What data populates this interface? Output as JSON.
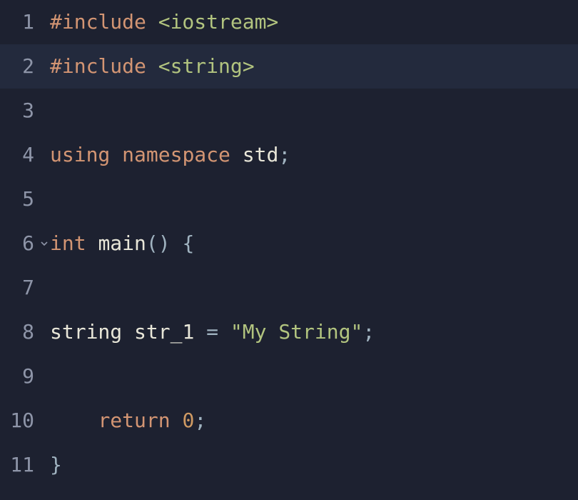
{
  "editor": {
    "highlighted_line_index": 1,
    "fold_marker_line_index": 5,
    "lines": [
      {
        "num": "1",
        "tokens": [
          {
            "t": "#include",
            "c": "tok-preproc"
          },
          {
            "t": " "
          },
          {
            "t": "<iostream>",
            "c": "tok-include"
          }
        ]
      },
      {
        "num": "2",
        "tokens": [
          {
            "t": "#include",
            "c": "tok-preproc"
          },
          {
            "t": " "
          },
          {
            "t": "<string>",
            "c": "tok-include"
          }
        ]
      },
      {
        "num": "3",
        "tokens": []
      },
      {
        "num": "4",
        "tokens": [
          {
            "t": "using",
            "c": "tok-keyword"
          },
          {
            "t": " "
          },
          {
            "t": "namespace",
            "c": "tok-keyword"
          },
          {
            "t": " "
          },
          {
            "t": "std",
            "c": "tok-ident"
          },
          {
            "t": ";",
            "c": "tok-punct"
          }
        ]
      },
      {
        "num": "5",
        "tokens": []
      },
      {
        "num": "6",
        "tokens": [
          {
            "t": "int",
            "c": "tok-type-kw"
          },
          {
            "t": " "
          },
          {
            "t": "main",
            "c": "tok-func"
          },
          {
            "t": "()",
            "c": "tok-punct"
          },
          {
            "t": " "
          },
          {
            "t": "{",
            "c": "tok-punct"
          }
        ]
      },
      {
        "num": "7",
        "tokens": []
      },
      {
        "num": "8",
        "tokens": [
          {
            "t": "string",
            "c": "tok-typeuser"
          },
          {
            "t": " "
          },
          {
            "t": "str_1",
            "c": "tok-ident"
          },
          {
            "t": " "
          },
          {
            "t": "=",
            "c": "tok-op"
          },
          {
            "t": " "
          },
          {
            "t": "\"My String\"",
            "c": "tok-string"
          },
          {
            "t": ";",
            "c": "tok-punct"
          }
        ]
      },
      {
        "num": "9",
        "tokens": []
      },
      {
        "num": "10",
        "tokens": [
          {
            "t": "    "
          },
          {
            "t": "return",
            "c": "tok-keyword"
          },
          {
            "t": " "
          },
          {
            "t": "0",
            "c": "tok-number"
          },
          {
            "t": ";",
            "c": "tok-punct"
          }
        ]
      },
      {
        "num": "11",
        "tokens": [
          {
            "t": "}",
            "c": "tok-punct"
          }
        ]
      }
    ]
  }
}
